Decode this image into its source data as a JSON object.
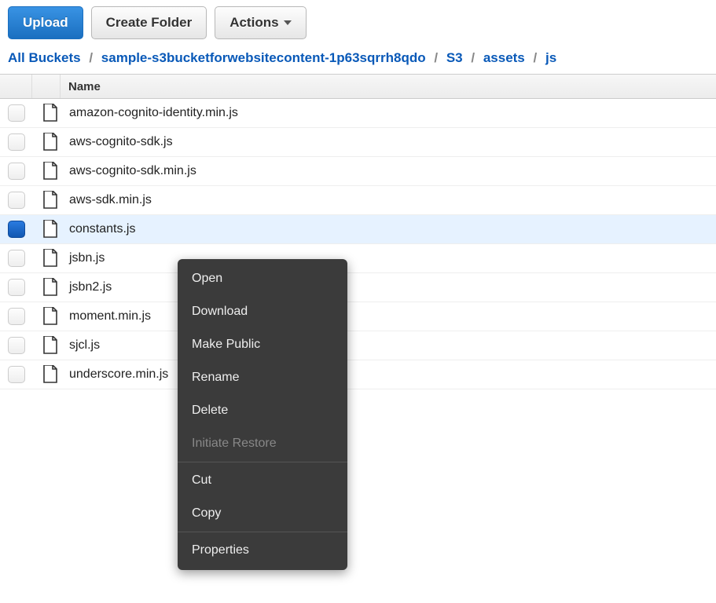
{
  "toolbar": {
    "upload_label": "Upload",
    "create_folder_label": "Create Folder",
    "actions_label": "Actions"
  },
  "breadcrumb": {
    "root": "All Buckets",
    "parts": [
      "sample-s3bucketforwebsitecontent-1p63sqrrh8qdo",
      "S3",
      "assets",
      "js"
    ]
  },
  "table": {
    "header_name": "Name"
  },
  "files": [
    {
      "name": "amazon-cognito-identity.min.js",
      "selected": false
    },
    {
      "name": "aws-cognito-sdk.js",
      "selected": false
    },
    {
      "name": "aws-cognito-sdk.min.js",
      "selected": false
    },
    {
      "name": "aws-sdk.min.js",
      "selected": false
    },
    {
      "name": "constants.js",
      "selected": true
    },
    {
      "name": "jsbn.js",
      "selected": false
    },
    {
      "name": "jsbn2.js",
      "selected": false
    },
    {
      "name": "moment.min.js",
      "selected": false
    },
    {
      "name": "sjcl.js",
      "selected": false
    },
    {
      "name": "underscore.min.js",
      "selected": false
    }
  ],
  "context_menu": {
    "open": "Open",
    "download": "Download",
    "make_public": "Make Public",
    "rename": "Rename",
    "delete": "Delete",
    "initiate_restore": "Initiate Restore",
    "cut": "Cut",
    "copy": "Copy",
    "properties": "Properties"
  }
}
